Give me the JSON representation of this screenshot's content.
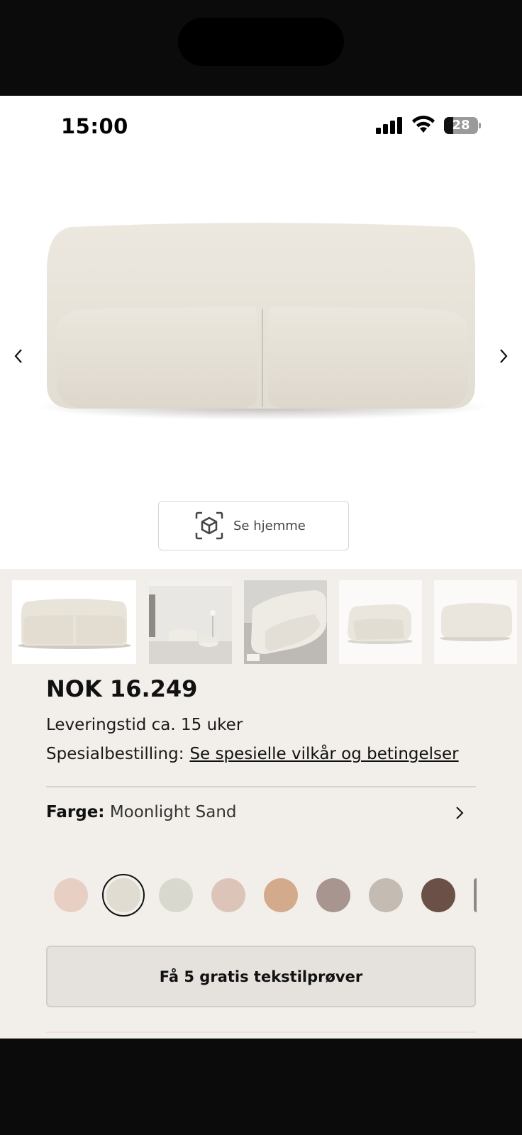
{
  "status_bar": {
    "time": "15:00",
    "battery_level": "28",
    "battery_fraction": 0.28
  },
  "gallery": {
    "prev_icon": "chevron-left-icon",
    "next_icon": "chevron-right-icon",
    "ar_button_label": "Se hjemme",
    "ar_icon": "ar-cube-icon"
  },
  "product": {
    "price": "NOK 16.249",
    "delivery": "Leveringstid ca. 15 uker",
    "special_order_label": "Spesialbestilling:",
    "special_order_link": "Se spesielle vilkår og betingelser",
    "color_label": "Farge:",
    "color_value": "Moonlight Sand",
    "swatches": [
      {
        "color": "#e8cfc4",
        "selected": false
      },
      {
        "color": "#e0dcd2",
        "selected": true
      },
      {
        "color": "#d8d8ce",
        "selected": false
      },
      {
        "color": "#dcc5b8",
        "selected": false
      },
      {
        "color": "#d4aa8c",
        "selected": false
      },
      {
        "color": "#a8958f",
        "selected": false
      },
      {
        "color": "#c4bcb2",
        "selected": false
      },
      {
        "color": "#6b5048",
        "selected": false
      },
      {
        "color": "#8a8a80",
        "selected": false
      }
    ],
    "cta_label": "Få 5 gratis tekstilprøver"
  },
  "colors": {
    "background": "#f2efea",
    "sofa_fabric": "#ebe6dd",
    "accent": "#111111"
  }
}
